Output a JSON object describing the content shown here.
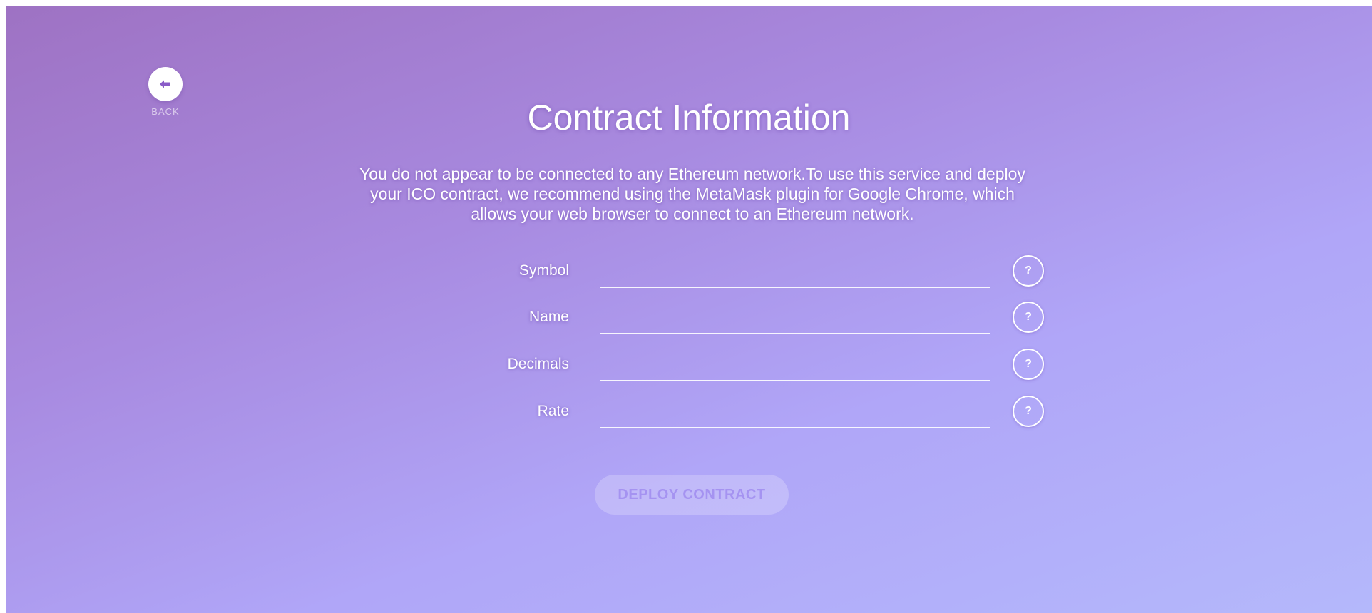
{
  "back": {
    "label": "BACK",
    "icon": "arrow-left-icon",
    "icon_color": "#8a5cc8"
  },
  "header": {
    "title": "Contract Information"
  },
  "notice": {
    "text": "You do not appear to be connected to any Ethereum network.To use this service and deploy your ICO contract, we recommend using the MetaMask plugin for Google Chrome, which allows your web browser to connect to an Ethereum network."
  },
  "form": {
    "fields": [
      {
        "label": "Symbol",
        "value": "",
        "help_label": "?"
      },
      {
        "label": "Name",
        "value": "",
        "help_label": "?"
      },
      {
        "label": "Decimals",
        "value": "",
        "help_label": "?"
      },
      {
        "label": "Rate",
        "value": "",
        "help_label": "?"
      }
    ]
  },
  "deploy": {
    "label": "DEPLOY CONTRACT"
  },
  "colors": {
    "gradient_start": "#9e72c3",
    "gradient_end": "#b4b8fb",
    "text": "#ffffff"
  }
}
